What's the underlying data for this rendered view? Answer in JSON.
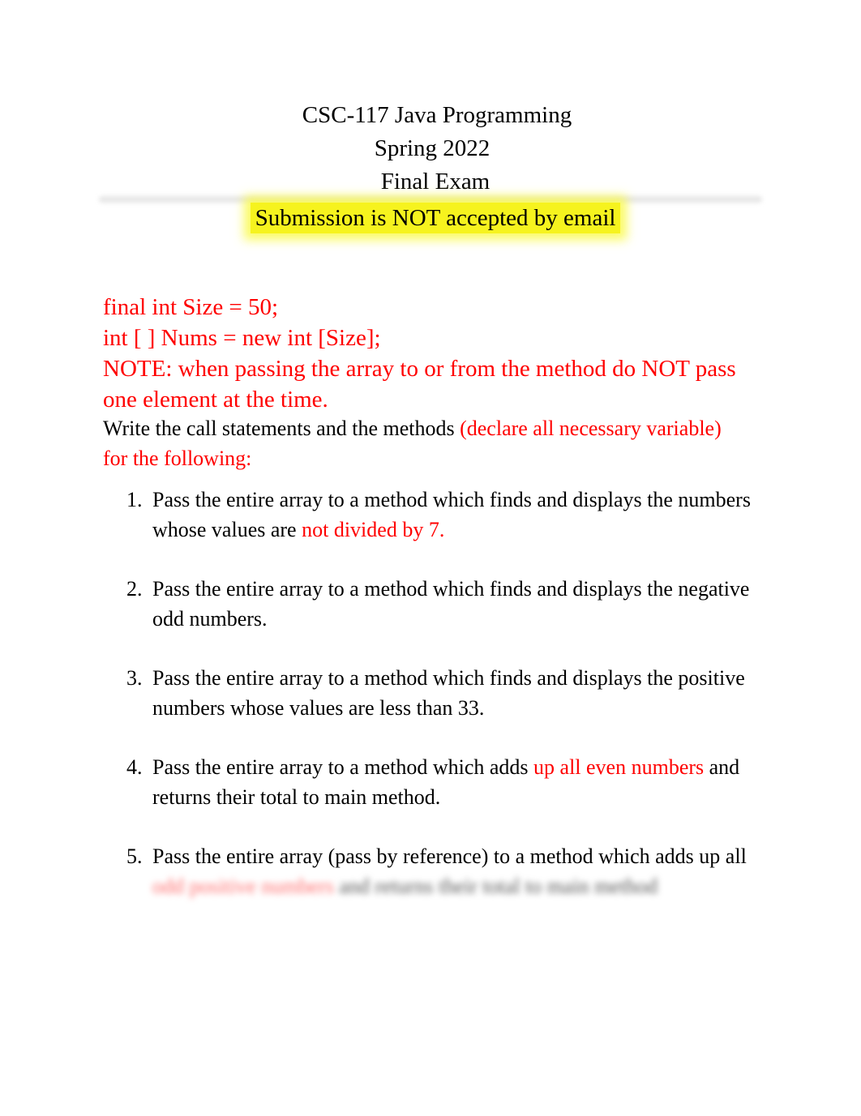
{
  "header": {
    "course": "CSC-117 Java Programming",
    "term": "Spring 2022",
    "exam": "Final Exam",
    "notice": "Submission is NOT accepted by email"
  },
  "code": {
    "line1": "final int Size = 50;",
    "line2": "int [ ] Nums = new int [Size];",
    "note": "NOTE: when passing the array to or from the method do NOT pass one element at the time."
  },
  "instructions": {
    "black": "Write the call statements   and the methods ",
    "red": " (declare all necessary variable) for the following:"
  },
  "tasks": [
    {
      "number": "1.",
      "text": "Pass the entire array to a method which finds and displays the numbers whose values are ",
      "highlight": " not divided by 7.",
      "tail": ""
    },
    {
      "number": "2.",
      "text": " Pass the entire array to a method which finds and displays the negative odd numbers.",
      "highlight": "",
      "tail": ""
    },
    {
      "number": "3.",
      "text": "Pass the entire array   to a method which finds and displays the positive numbers whose values are less than 33.",
      "highlight": "",
      "tail": ""
    },
    {
      "number": "4.",
      "text": "Pass the entire array to a method which adds ",
      "highlight": "  up all even numbers",
      "tail": " and returns their total to main method."
    },
    {
      "number": "5.",
      "text": "Pass the entire array (pass by reference) to a method which adds up all ",
      "highlight": "odd positive numbers",
      "tail": " and returns their total to main method"
    }
  ],
  "colors": {
    "accent_red": "#ff0000",
    "highlight_yellow": "#f6f31e"
  }
}
